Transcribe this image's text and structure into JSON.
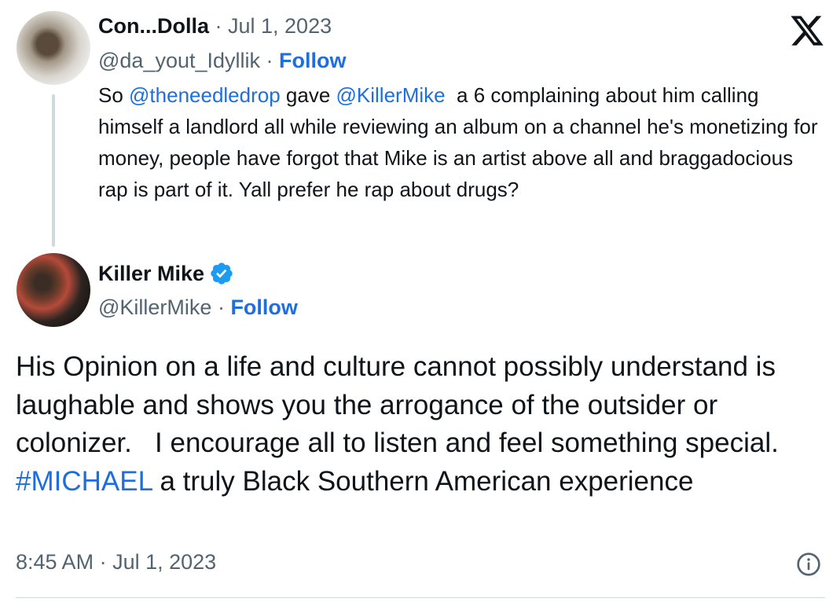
{
  "quoted_tweet": {
    "display_name": "Con...Dolla",
    "date": "Jul 1, 2023",
    "handle": "@da_yout_Idyllik",
    "follow_label": "Follow",
    "text_1": "So ",
    "mention_1": "@theneedledrop",
    "text_2": " gave ",
    "mention_2": "@KillerMike",
    "text_3": "  a 6 complaining about him calling himself a landlord all while reviewing an album on a channel he's monetizing for money, people have forgot that Mike is an artist above all and braggadocious rap is part of it. Yall prefer he rap about drugs?"
  },
  "reply_tweet": {
    "display_name": "Killer Mike",
    "verified": true,
    "handle": "@KillerMike",
    "follow_label": "Follow",
    "text_1": "His Opinion on a life and culture cannot possibly understand is laughable and shows you the arrogance of the outsider or colonizer.   I encourage all to listen and feel something special.  ",
    "hashtag": "#MICHAEL",
    "text_2": " a truly Black Southern American experience",
    "time": "8:45 AM",
    "date": "Jul 1, 2023"
  },
  "separator": " · ",
  "icons": {
    "x_logo": "x-logo-icon",
    "verified": "verified-badge-icon",
    "info": "info-icon"
  },
  "colors": {
    "link": "#1d6fe0",
    "muted": "#536471",
    "verified_blue": "#1d9bf0",
    "text": "#0f1419"
  }
}
